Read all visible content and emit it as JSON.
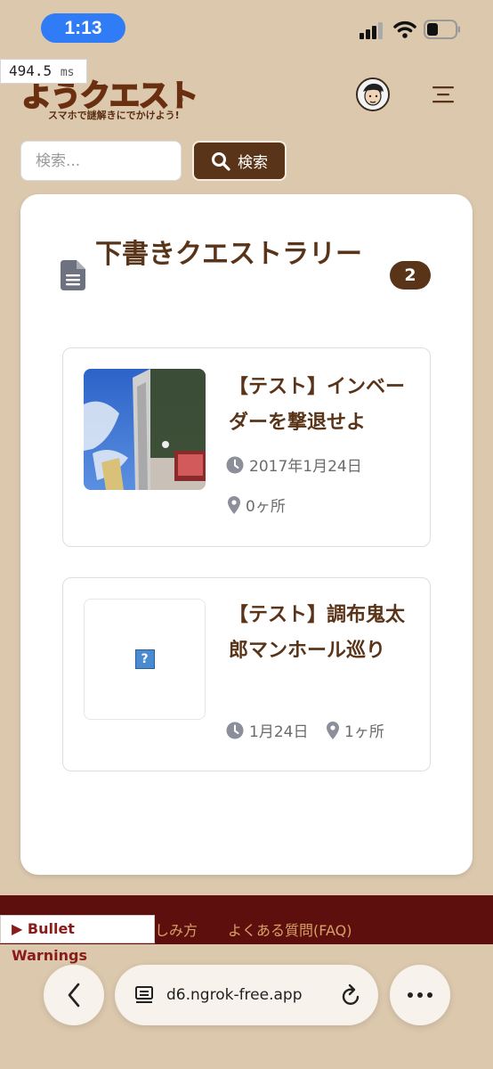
{
  "status_bar": {
    "time": "1:13"
  },
  "perf": {
    "value": "494.5",
    "unit": "ms"
  },
  "header": {
    "logo_text": "ようクエスト",
    "logo_tagline": "スマホで謎解きにでかけよう!",
    "logo_mark": "®"
  },
  "search": {
    "placeholder": "検索...",
    "button_label": "検索"
  },
  "section": {
    "title": "下書きクエストラリー",
    "count": "2"
  },
  "quests": [
    {
      "title": "【テスト】インベーダーを撃退せよ",
      "date": "2017年1月24日",
      "spots": "0ヶ所",
      "has_image": true
    },
    {
      "title": "【テスト】調布鬼太郎マンホール巡り",
      "date": "1月24日",
      "spots": "1ヶ所",
      "has_image": false
    }
  ],
  "footer": {
    "links": [
      "しみ方",
      "よくある質問(FAQ)"
    ]
  },
  "bullet_warnings": {
    "label": "Bullet Warnings",
    "marker": "▶"
  },
  "browser": {
    "url": "d6.ngrok-free.app"
  },
  "icons": [
    "signal-icon",
    "wifi-icon",
    "battery-icon",
    "menu-icon",
    "search-icon",
    "document-icon",
    "clock-icon",
    "location-pin-icon",
    "broken-image-icon",
    "back-icon",
    "reader-icon",
    "reload-icon",
    "more-icon"
  ],
  "colors": {
    "background": "#dcc8ad",
    "brand_brown": "#5a3418",
    "footer": "#5c0f0c",
    "time_pill": "#2f7cf6"
  }
}
